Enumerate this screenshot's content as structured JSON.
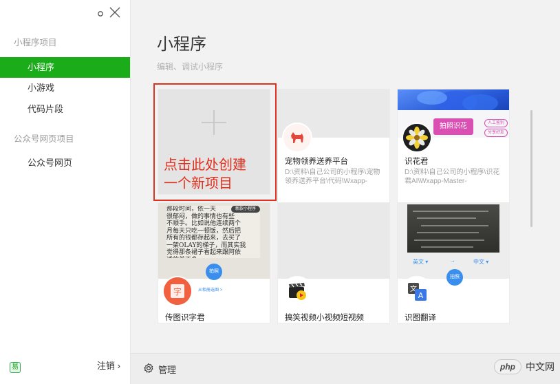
{
  "sidebar": {
    "section1_title": "小程序项目",
    "items1": [
      {
        "label": "小程序",
        "active": true
      },
      {
        "label": "小游戏",
        "active": false
      },
      {
        "label": "代码片段",
        "active": false
      }
    ],
    "section2_title": "公众号网页项目",
    "items2": [
      {
        "label": "公众号网页",
        "active": false
      }
    ],
    "logout_label": "注销",
    "logout_arrow": "›"
  },
  "main": {
    "title": "小程序",
    "subtitle": "编辑、调试小程序",
    "create_label_line1": "点击此处创建",
    "create_label_line2": "一个新项目",
    "projects": [
      {
        "name": "宠物领养送养平台",
        "path": "D:\\资料\\自己公司的小程序\\宠物领养送养平台\\代码\\Wxapp-",
        "icon": "dog-icon"
      },
      {
        "name": "识花君",
        "path": "D:\\资料\\自己公司的小程序\\识花君AI\\Wxapp-Master-",
        "icon": "flower-icon"
      },
      {
        "name": "传图识字君",
        "path": "",
        "icon": "text-recognition-icon"
      },
      {
        "name": "搞笑视频小视频短视频",
        "path": "",
        "icon": "video-clapper-icon"
      },
      {
        "name": "识图翻译",
        "path": "",
        "icon": "translate-icon"
      }
    ],
    "thumb_texts": {
      "flower_btn": "拍照识花",
      "flower_tag1": "人工鉴别",
      "flower_tag2": "分享好友",
      "scan_label": "从相册选图 >",
      "lang_from": "英文",
      "lang_arrow": "→",
      "lang_to": "中文",
      "ocr_text": "那段时间，依一天\n很郁闷，做的事情也有些\n不顺手。比如说他连续两个\n月每天只吃一顿饭，然后把\n所有的钱都存起来，去买了\n一架OLAY的梯子，而其实我\n觉得那条裙子看起来跟阿依\n适的差不多。",
      "ocr_badge": "新款小程序",
      "shoot_label": "拍照"
    }
  },
  "bottom": {
    "manage_label": "管理",
    "php_label": "php",
    "php_site": "中文网"
  },
  "colors": {
    "accent": "#1aad19",
    "highlight": "#e0301e"
  }
}
